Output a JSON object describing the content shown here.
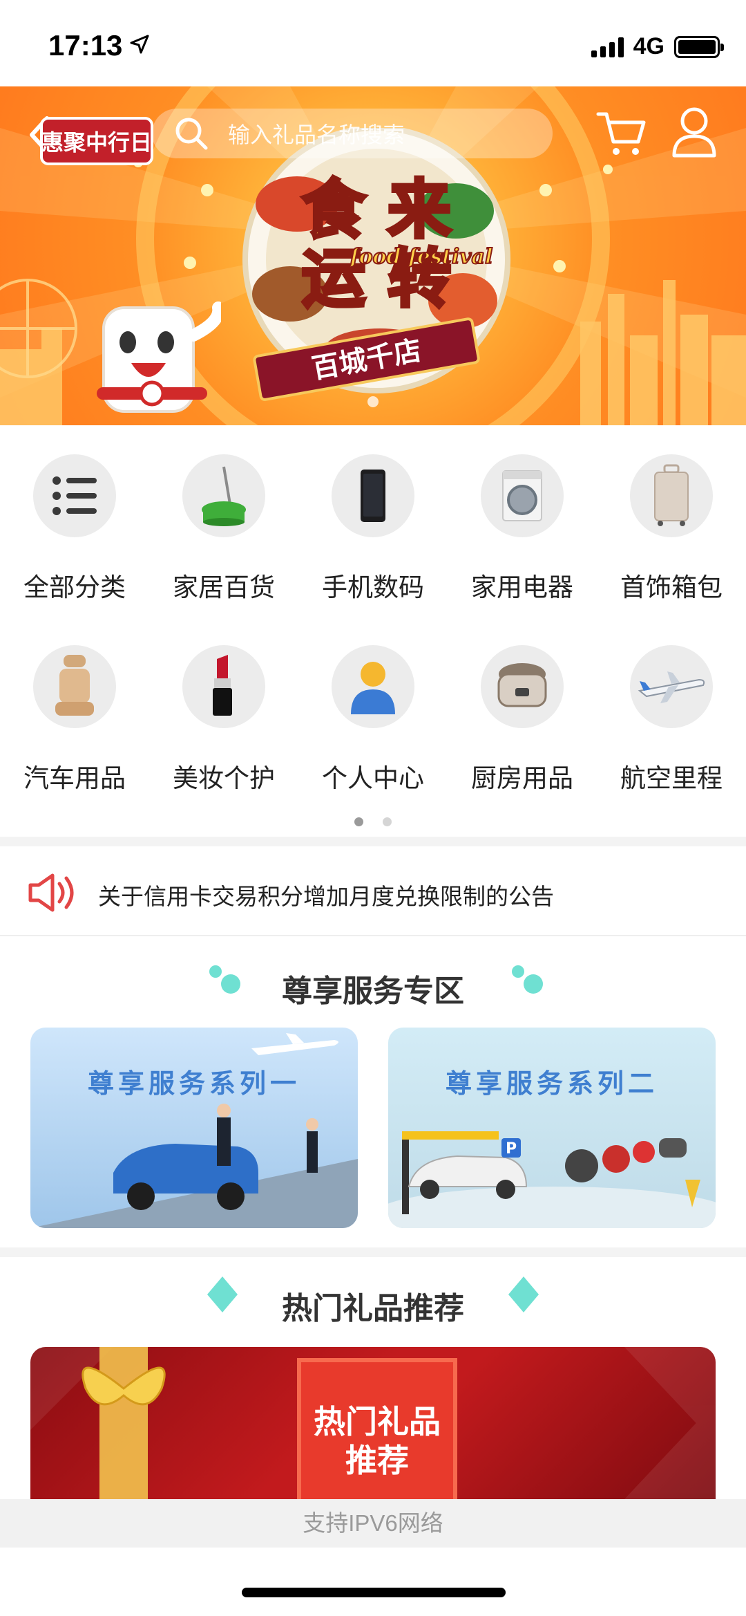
{
  "status_bar": {
    "time": "17:13",
    "network": "4G"
  },
  "hero": {
    "search_placeholder": "输入礼品名称搜索",
    "logo_text": "惠聚中行日",
    "banner_caption": "百城千店"
  },
  "categories": [
    {
      "label": "全部分类",
      "icon": "list-icon"
    },
    {
      "label": "家居百货",
      "icon": "mop-bucket-icon"
    },
    {
      "label": "手机数码",
      "icon": "phone-icon"
    },
    {
      "label": "家用电器",
      "icon": "washing-machine-icon"
    },
    {
      "label": "首饰箱包",
      "icon": "suitcase-icon"
    },
    {
      "label": "汽车用品",
      "icon": "car-seat-icon"
    },
    {
      "label": "美妆个护",
      "icon": "lipstick-icon"
    },
    {
      "label": "个人中心",
      "icon": "person-icon"
    },
    {
      "label": "厨房用品",
      "icon": "rice-cooker-icon"
    },
    {
      "label": "航空里程",
      "icon": "airplane-icon"
    }
  ],
  "notice": {
    "text": "关于信用卡交易积分增加月度兑换限制的公告"
  },
  "service_section": {
    "title": "尊享服务专区",
    "cards": [
      {
        "title": "尊享服务系列一"
      },
      {
        "title": "尊享服务系列二"
      }
    ]
  },
  "gift_section": {
    "title": "热门礼品推荐",
    "banner_line1": "热门礼品",
    "banner_line2": "推荐"
  },
  "footer": {
    "text": "支持IPV6网络"
  },
  "colors": {
    "accent_teal": "#6fe0d2",
    "notice_red": "#e24646",
    "hero_orange": "#ff8f24",
    "gift_red": "#c21a1d"
  }
}
